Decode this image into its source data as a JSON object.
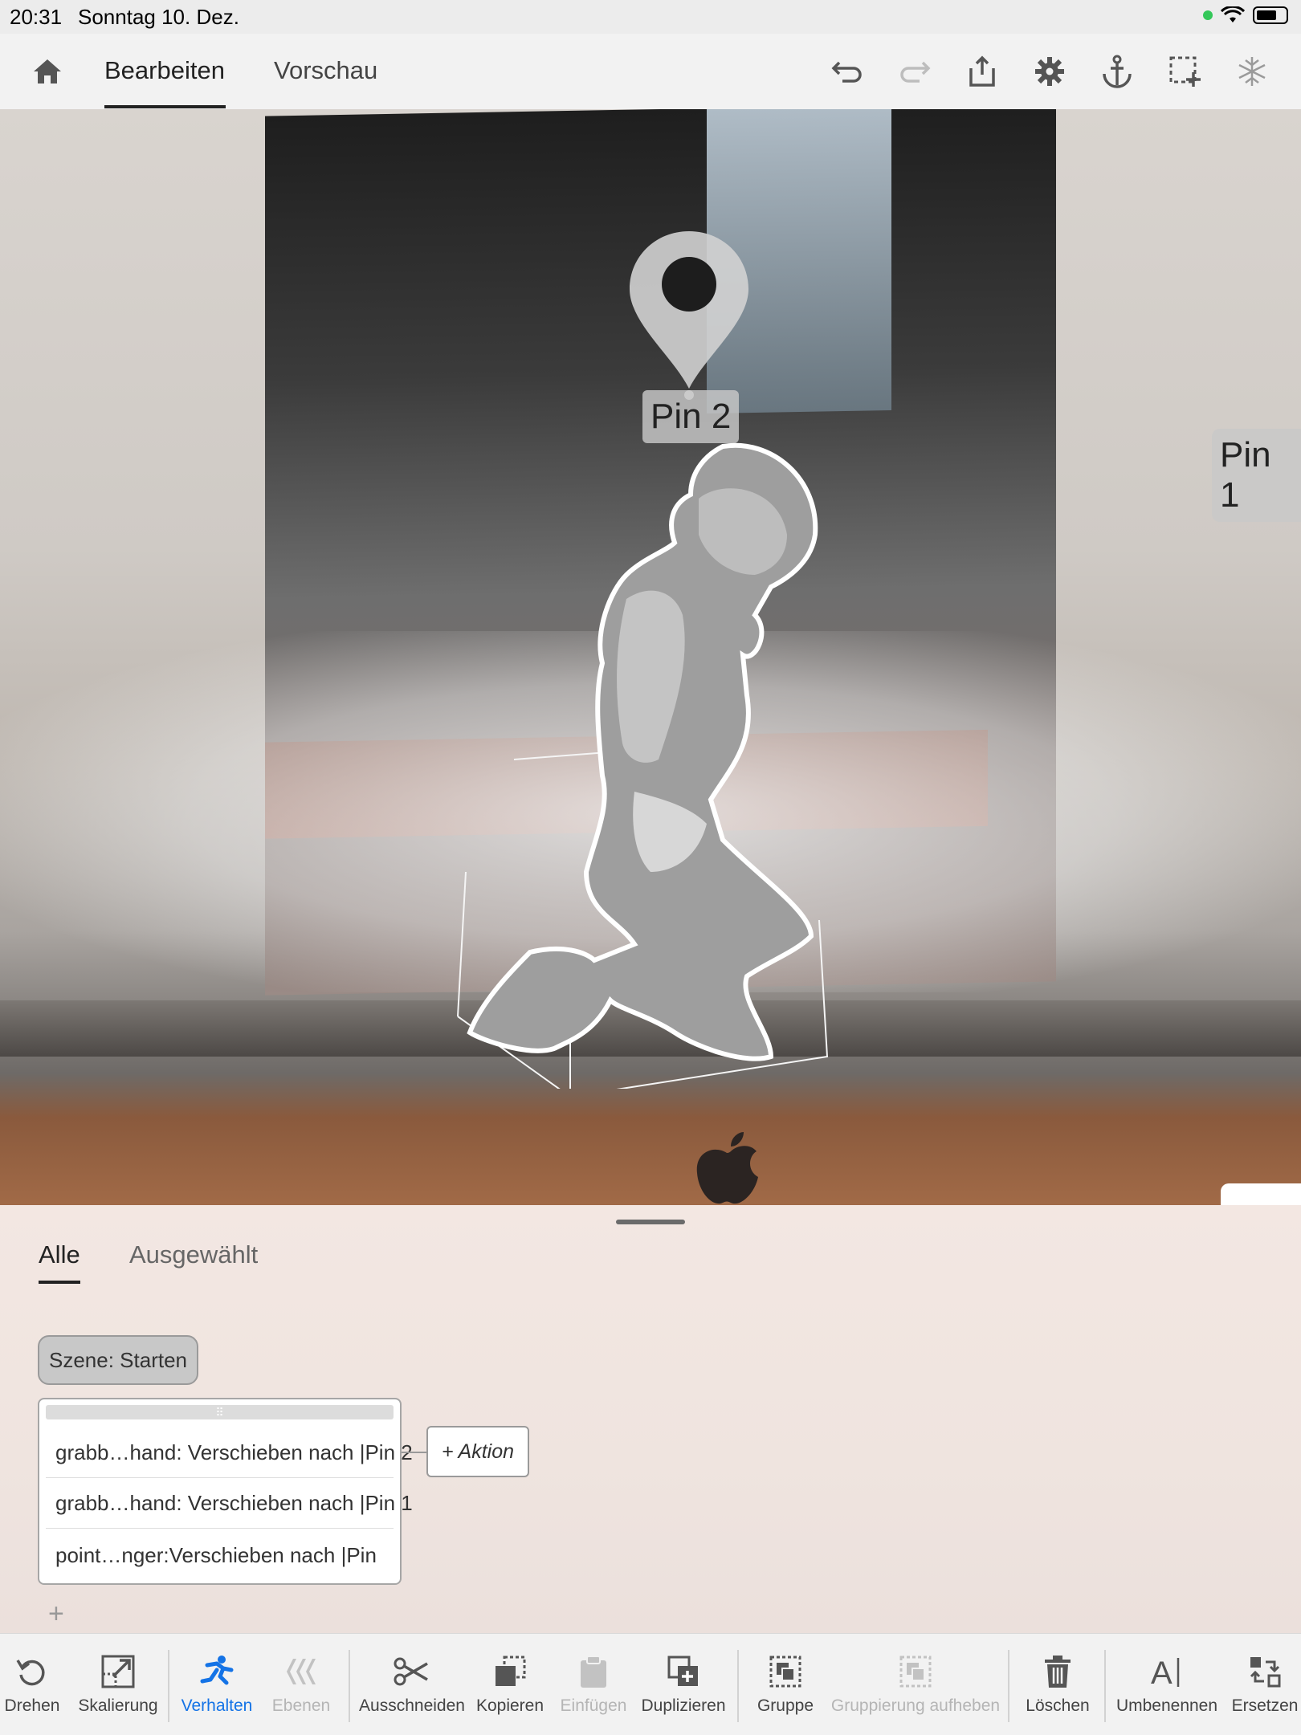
{
  "status": {
    "time": "20:31",
    "date": "Sonntag 10. Dez."
  },
  "nav": {
    "tabs": [
      {
        "label": "Bearbeiten",
        "active": true
      },
      {
        "label": "Vorschau",
        "active": false
      }
    ],
    "tools": [
      "undo-icon",
      "redo-icon",
      "share-icon",
      "settings-icon",
      "anchor-icon",
      "select-add-icon",
      "hierarchy-icon"
    ]
  },
  "scene": {
    "pin_top_label": "Pin 2",
    "pin_right_label": "Pin 1"
  },
  "panel": {
    "tabs": [
      {
        "label": "Alle",
        "active": true
      },
      {
        "label": "Ausgewählt",
        "active": false
      }
    ],
    "trigger_label": "Szene: Starten",
    "actions": [
      "grabb…hand: Verschieben nach |Pin 2",
      "grabb…hand: Verschieben nach |Pin 1",
      "point…nger:Verschieben nach |Pin"
    ],
    "add_action_label": "+ Aktion",
    "add_trigger_label": "+"
  },
  "toolbar": [
    {
      "label": "Drehen",
      "icon": "rotate-icon",
      "state": "normal"
    },
    {
      "label": "Skalierung",
      "icon": "scale-icon",
      "state": "normal"
    },
    {
      "label": "Verhalten",
      "icon": "behavior-icon",
      "state": "selected"
    },
    {
      "label": "Ebenen",
      "icon": "layers-icon",
      "state": "disabled"
    },
    {
      "label": "Ausschneiden",
      "icon": "cut-icon",
      "state": "normal"
    },
    {
      "label": "Kopieren",
      "icon": "copy-icon",
      "state": "normal"
    },
    {
      "label": "Einfügen",
      "icon": "paste-icon",
      "state": "disabled"
    },
    {
      "label": "Duplizieren",
      "icon": "duplicate-icon",
      "state": "normal"
    },
    {
      "label": "Gruppe",
      "icon": "group-icon",
      "state": "normal"
    },
    {
      "label": "Gruppierung aufheben",
      "icon": "ungroup-icon",
      "state": "disabled"
    },
    {
      "label": "Löschen",
      "icon": "trash-icon",
      "state": "normal"
    },
    {
      "label": "Umbenennen",
      "icon": "rename-icon",
      "state": "normal"
    },
    {
      "label": "Ersetzen",
      "icon": "replace-icon",
      "state": "normal"
    }
  ],
  "colors": {
    "accent": "#1473e6",
    "disabled": "#b5b5b5",
    "status_dot": "#34c759"
  }
}
